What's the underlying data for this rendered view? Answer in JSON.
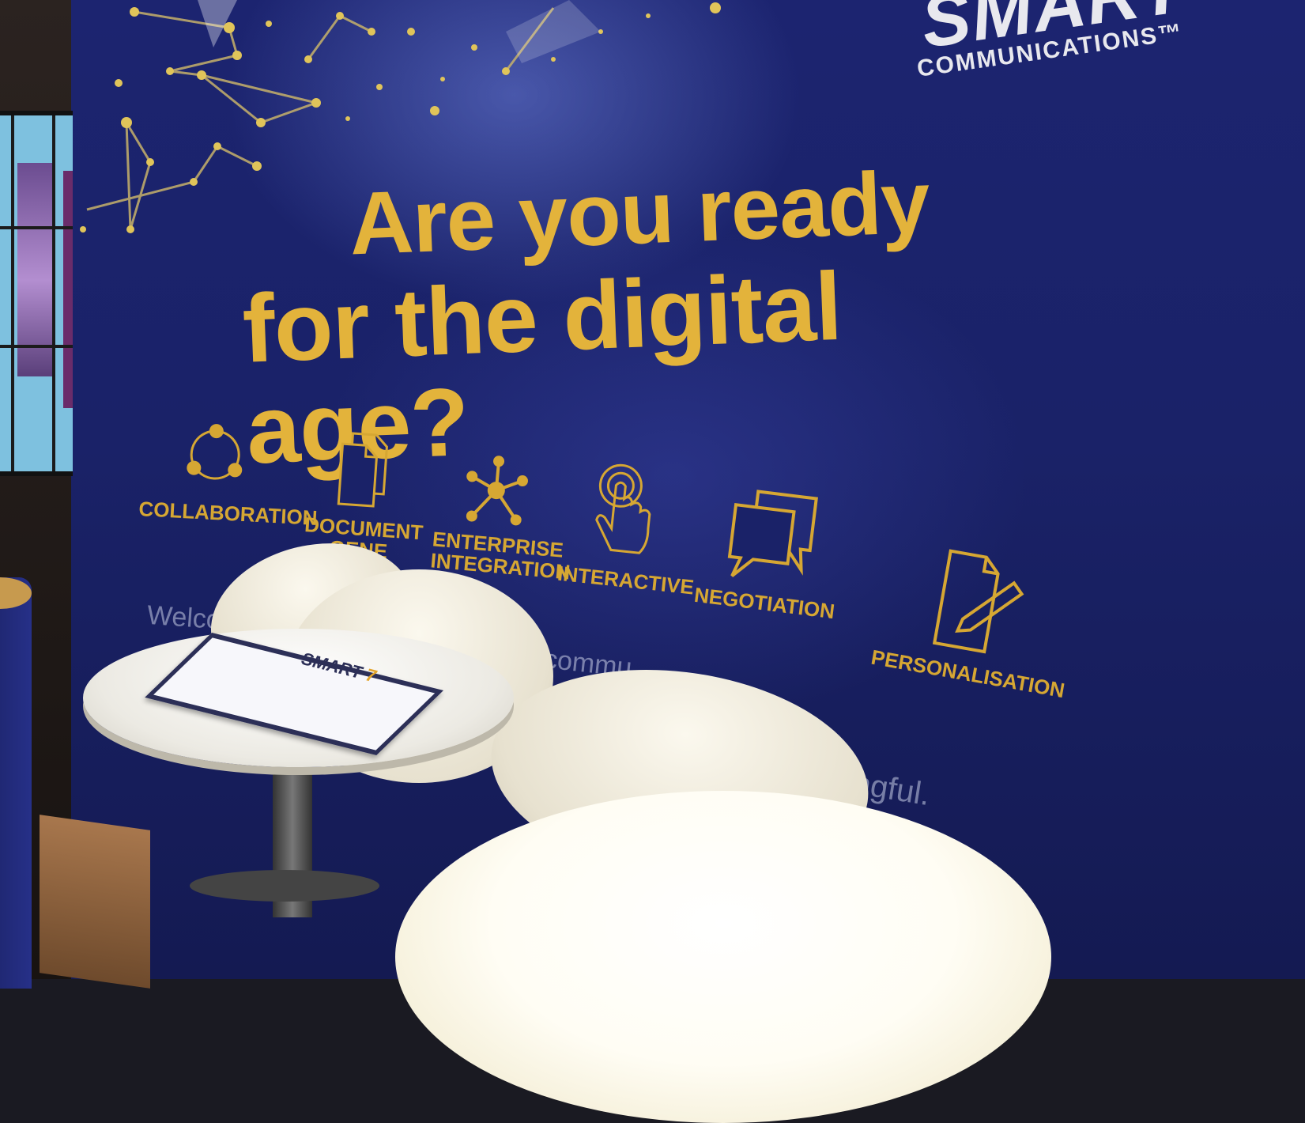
{
  "brand": {
    "logo_mark": "SMART",
    "logo_sub": "COMMUNICATIONS™"
  },
  "headline": {
    "line1": "Are you ready",
    "line2": "for the digital age?"
  },
  "features": [
    {
      "label": "COLLABORATION",
      "icon": "collaboration-icon"
    },
    {
      "label": "DOCUMENT GENE",
      "icon": "document-icon"
    },
    {
      "label": "ENTERPRISE INTEGRATION",
      "icon": "network-icon"
    },
    {
      "label": "INTERACTIVE",
      "icon": "touch-icon"
    },
    {
      "label": "NEGOTIATION",
      "icon": "chat-bubbles-icon"
    },
    {
      "label": "PERSONALISATION",
      "icon": "document-edit-icon"
    }
  ],
  "body_fragments": {
    "welcome": "Welco",
    "commu": "commu",
    "ingful": "ingful."
  },
  "brochure": {
    "logo_mark": "SMART",
    "logo_accent": "7"
  },
  "colors": {
    "wall": "#1a2268",
    "accent_gold": "#e3b33b",
    "logo_white": "#e8e8ee"
  }
}
